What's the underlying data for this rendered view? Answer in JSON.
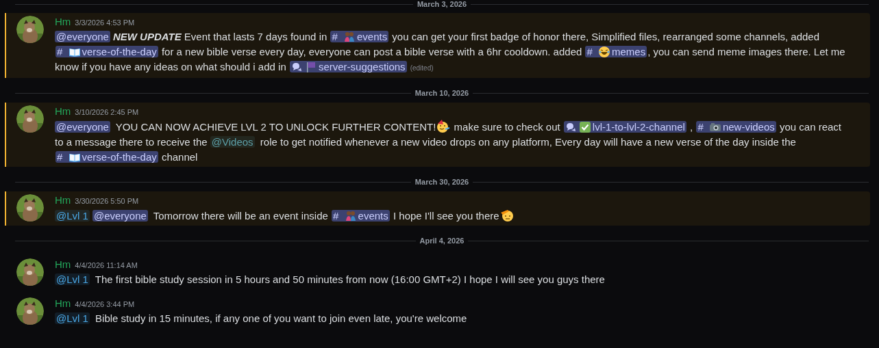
{
  "feed": [
    {
      "kind": "divider",
      "date": "March 3, 2026"
    },
    {
      "kind": "message",
      "mentioned": true,
      "author": "Hm",
      "timestamp": "3/3/2026 4:53 PM",
      "parts": [
        {
          "kind": "mention",
          "text": "@everyone"
        },
        {
          "kind": "strong",
          "text": "NEW UPDATE"
        },
        {
          "kind": "text",
          "text": " Event that lasts 7 days found in "
        },
        {
          "kind": "channel",
          "glyph": "#",
          "icon": {
            "kind": "people"
          },
          "text": "events"
        },
        {
          "kind": "text",
          "text": " you can get your first badge of honor there, Simplified files, rearranged some channels, added "
        },
        {
          "kind": "channel",
          "glyph": "#",
          "icon": {
            "kind": "book"
          },
          "text": "verse-of-the-day"
        },
        {
          "kind": "text",
          "text": " for a new bible verse every day, everyone can post a bible verse with a 6hr cooldown. added "
        },
        {
          "kind": "channel",
          "glyph": "#",
          "icon": {
            "kind": "laughing"
          },
          "text": "memes"
        },
        {
          "kind": "text",
          "text": ", you can send meme images there. Let me know if you have any ideas on what should i add in "
        },
        {
          "kind": "channel",
          "icon": {
            "kind": "flag"
          },
          "text": "server-suggestions"
        },
        {
          "kind": "edited",
          "text": "(edited)"
        }
      ]
    },
    {
      "kind": "divider",
      "date": "March 10, 2026"
    },
    {
      "kind": "message",
      "mentioned": true,
      "author": "Hm",
      "timestamp": "3/10/2026 2:45 PM",
      "parts": [
        {
          "kind": "mention",
          "text": "@everyone"
        },
        {
          "kind": "text",
          "text": " YOU CAN NOW ACHIEVE LVL 2 TO UNLOCK FURTHER CONTENT!"
        },
        {
          "kind": "emoji",
          "icon": {
            "kind": "party"
          }
        },
        {
          "kind": "text",
          "text": " make sure to check out "
        },
        {
          "kind": "channel",
          "icon": {
            "kind": "check"
          },
          "text": "lvl-1-to-lvl-2-channel"
        },
        {
          "kind": "text",
          "text": " , "
        },
        {
          "kind": "channel",
          "glyph": "#",
          "icon": {
            "kind": "camera"
          },
          "text": "new-videos"
        },
        {
          "kind": "text",
          "text": " you can react to a message there to receive the "
        },
        {
          "kind": "role",
          "text": "@Videos",
          "color": "#5c9ea6"
        },
        {
          "kind": "text",
          "text": " role to get notified whenever a new video drops on any platform, Every day will have a new verse of the day inside the "
        },
        {
          "kind": "channel",
          "glyph": "#",
          "icon": {
            "kind": "book"
          },
          "text": "verse-of-the-day"
        },
        {
          "kind": "text",
          "text": " channel"
        }
      ]
    },
    {
      "kind": "divider",
      "date": "March 30, 2026"
    },
    {
      "kind": "message",
      "mentioned": true,
      "author": "Hm",
      "timestamp": "3/30/2026 5:50 PM",
      "parts": [
        {
          "kind": "role",
          "text": "@Lvl 1",
          "color": "#4aa8e6"
        },
        {
          "kind": "mention",
          "text": "@everyone"
        },
        {
          "kind": "text",
          "text": " Tomorrow there will be an event inside "
        },
        {
          "kind": "channel",
          "glyph": "#",
          "icon": {
            "kind": "people"
          },
          "text": "events"
        },
        {
          "kind": "text",
          "text": " I hope I'll see you there"
        },
        {
          "kind": "emoji",
          "icon": {
            "kind": "salute"
          }
        }
      ]
    },
    {
      "kind": "divider",
      "date": "April 4, 2026"
    },
    {
      "kind": "message",
      "mentioned": false,
      "author": "Hm",
      "timestamp": "4/4/2026 11:14 AM",
      "parts": [
        {
          "kind": "role",
          "text": "@Lvl 1",
          "color": "#4aa8e6"
        },
        {
          "kind": "text",
          "text": " The first bible study session in 5 hours and 50 minutes from now (16:00 GMT+2) I hope I will see you guys there"
        }
      ]
    },
    {
      "kind": "message",
      "mentioned": false,
      "author": "Hm",
      "timestamp": "4/4/2026 3:44 PM",
      "parts": [
        {
          "kind": "role",
          "text": "@Lvl 1",
          "color": "#4aa8e6"
        },
        {
          "kind": "text",
          "text": " Bible study in 15 minutes, if any one of you want to join even late, you're welcome"
        }
      ]
    }
  ]
}
